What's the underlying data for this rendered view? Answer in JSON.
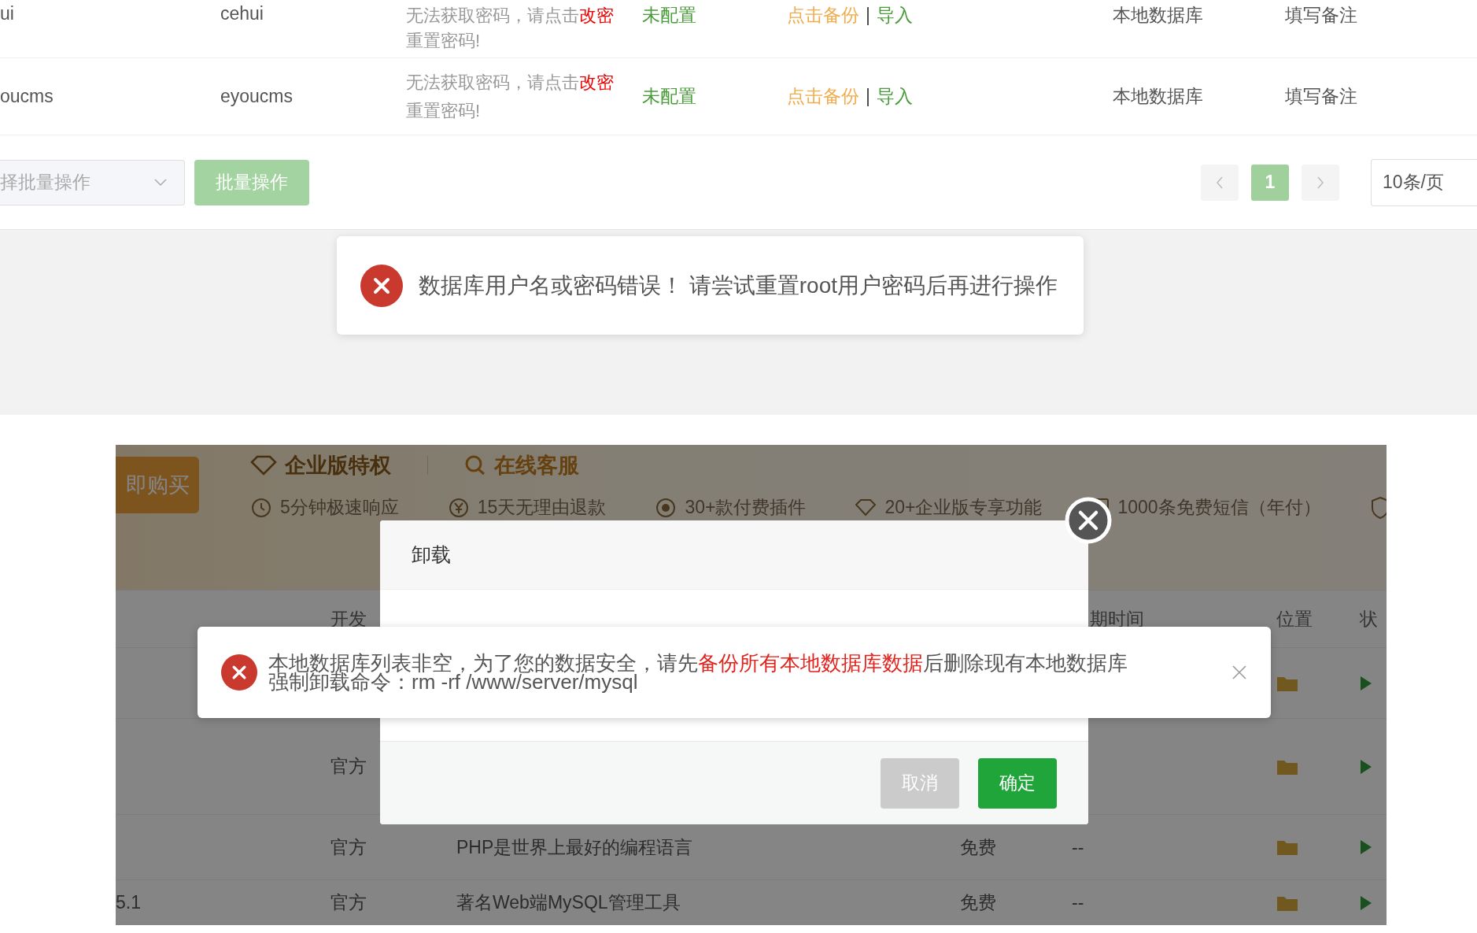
{
  "db_table": {
    "rows": [
      {
        "name": "ui",
        "username": "cehui",
        "password": [
          {
            "text": "无法获取密码，请点击",
            "link": false
          },
          {
            "text": "改密",
            "link": true
          },
          {
            "text": "重置密码!",
            "link": false
          }
        ],
        "backup": "未配置",
        "backup_action": "点击备份",
        "separator": "|",
        "import_action": "导入",
        "location": "本地数据库",
        "remark": "填写备注"
      },
      {
        "name": "oucms",
        "username": "eyoucms",
        "password": [
          {
            "text": "无法获取密码，请点击",
            "link": false
          },
          {
            "text": "改密",
            "link": true
          },
          {
            "text": "重置密码!",
            "link": false
          }
        ],
        "backup": "未配置",
        "backup_action": "点击备份",
        "separator": "|",
        "import_action": "导入",
        "location": "本地数据库",
        "remark": "填写备注"
      }
    ]
  },
  "batch": {
    "placeholder": "择批量操作",
    "button": "批量操作",
    "disabled": true
  },
  "pagination": {
    "pages": [
      {
        "label": "1",
        "selected": true
      }
    ],
    "page_size": "10条/页"
  },
  "toast": {
    "message": "数据库用户名或密码错误！ 请尝试重置root用户密码后再进行操作"
  },
  "software_panel": {
    "banner": {
      "buy_button": "即购买",
      "title": "企业版特权",
      "service": "在线客服",
      "features": [
        {
          "kind": "speed",
          "text": "5分钟极速响应"
        },
        {
          "kind": "refund",
          "text": "15天无理由退款"
        },
        {
          "kind": "plugins",
          "text": "30+款付费插件"
        },
        {
          "kind": "diamond",
          "text": "20+企业版专享功能"
        },
        {
          "kind": "sms",
          "text": "1000条免费短信（年付）"
        },
        {
          "kind": "shield"
        }
      ]
    },
    "table": {
      "header": {
        "developer": "开发",
        "expiry": "期时间",
        "location": "位置",
        "status": "状"
      },
      "rows": [
        {
          "kind": "plugin"
        },
        {
          "kind": "plugin",
          "developer": "官方"
        },
        {
          "kind": "plugin",
          "developer": "官方",
          "description": "PHP是世界上最好的编程语言",
          "price": "免费",
          "expiry": "--"
        },
        {
          "kind": "plugin",
          "version": "5.1",
          "developer": "官方",
          "description": "著名Web端MySQL管理工具",
          "price": "免费",
          "expiry": "--"
        }
      ]
    },
    "dialog": {
      "title": "卸载",
      "buttons": [
        {
          "kind": "cancel",
          "label": "取消"
        },
        {
          "kind": "confirm",
          "label": "确定"
        }
      ]
    },
    "alert": {
      "lines": [
        [
          {
            "text": "本地数据库列表非空，为了您的数据安全，请先",
            "emphasis": false
          },
          {
            "text": "备份所有本地数据库数据",
            "emphasis": true
          },
          {
            "text": "后删除现有本地数据库",
            "emphasis": false
          }
        ],
        [
          {
            "text": "强制卸载命令：rm -rf /www/server/mysql",
            "emphasis": false
          }
        ]
      ]
    }
  }
}
